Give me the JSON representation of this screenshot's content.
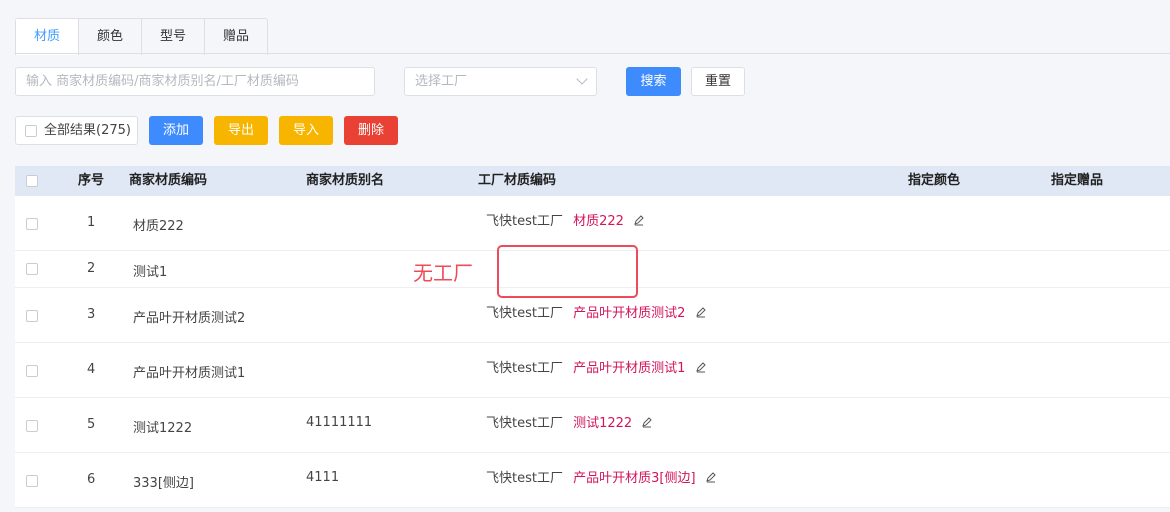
{
  "tabs": [
    {
      "label": "材质",
      "active": true
    },
    {
      "label": "颜色",
      "active": false
    },
    {
      "label": "型号",
      "active": false
    },
    {
      "label": "赠品",
      "active": false
    }
  ],
  "filters": {
    "search_placeholder": "输入 商家材质编码/商家材质别名/工厂材质编码",
    "factory_placeholder": "选择工厂",
    "search_label": "搜索",
    "reset_label": "重置"
  },
  "actions": {
    "all_results_label": "全部结果(275)",
    "add_label": "添加",
    "export_label": "导出",
    "import_label": "导入",
    "delete_label": "删除"
  },
  "table": {
    "columns": [
      "序号",
      "商家材质编码",
      "商家材质别名",
      "工厂材质编码",
      "指定颜色",
      "指定赠品"
    ],
    "rows": [
      {
        "index": "1",
        "code": "材质222",
        "alias": "",
        "factory": "飞快test工厂",
        "factory_code": "材质222"
      },
      {
        "index": "2",
        "code": "测试1",
        "alias": "",
        "factory": "",
        "factory_code": ""
      },
      {
        "index": "3",
        "code": "产品叶开材质测试2",
        "alias": "",
        "factory": "飞快test工厂",
        "factory_code": "产品叶开材质测试2"
      },
      {
        "index": "4",
        "code": "产品叶开材质测试1",
        "alias": "",
        "factory": "飞快test工厂",
        "factory_code": "产品叶开材质测试1"
      },
      {
        "index": "5",
        "code": "测试1222",
        "alias": "41111111",
        "factory": "飞快test工厂",
        "factory_code": "测试1222"
      },
      {
        "index": "6",
        "code": "333[侧边]",
        "alias": "4111",
        "factory": "飞快test工厂",
        "factory_code": "产品叶开材质3[侧边]"
      }
    ]
  },
  "annotation": {
    "text": "无工厂",
    "color": "#ee4b5a"
  },
  "colors": {
    "primary": "#3d8bfd",
    "warning": "#f7b500",
    "danger": "#e94235",
    "code": "#d4145a"
  }
}
